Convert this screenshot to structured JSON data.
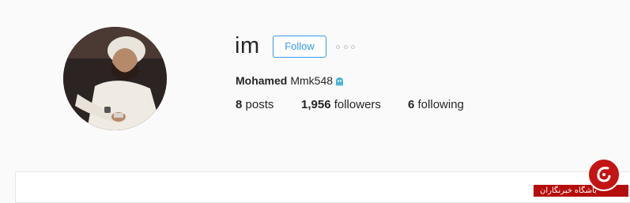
{
  "profile": {
    "username": "im",
    "follow_label": "Follow",
    "more_icon": "more-options-icon",
    "full_name": "Mohamed",
    "name_rest": "Mmk548",
    "emoji_icon": "ghost-emoji-icon"
  },
  "stats": {
    "posts_count": "8",
    "posts_label": "posts",
    "followers_count": "1,956",
    "followers_label": "followers",
    "following_count": "6",
    "following_label": "following"
  },
  "watermark": {
    "text": "باشگاه خبرنگاران"
  },
  "colors": {
    "accent": "#3897f0",
    "background": "#fafafa",
    "text": "#262626",
    "watermark_red": "#c41414"
  }
}
